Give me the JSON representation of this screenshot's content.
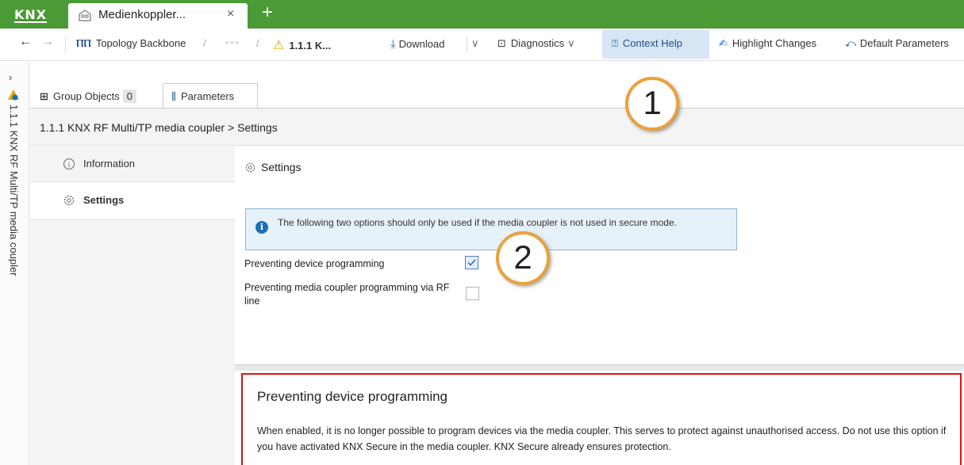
{
  "app": {
    "logo_text": "KNX",
    "tab_title": "Medienkoppler...",
    "tab_close": "×",
    "add_tab": "+"
  },
  "toolbar": {
    "back": "←",
    "forward": "→",
    "topology": "Topology Backbone",
    "slash1": "/",
    "ellipsis": "∘∘∘",
    "slash2": "/",
    "device": "1.1.1 K...",
    "download": "Download",
    "diagnostics": "Diagnostics",
    "context_help": "Context Help",
    "highlight_changes": "Highlight Changes",
    "default_parameters": "Default Parameters"
  },
  "side_strip": {
    "expand": "›",
    "device_label": "1.1.1 KNX RF Multi/TP media coupler"
  },
  "panel_tabs": {
    "group_objects": "Group Objects",
    "group_objects_count": "0",
    "parameters": "Parameters"
  },
  "breadcrumb": "1.1.1 KNX RF Multi/TP media coupler > Settings",
  "nav": {
    "items": [
      {
        "label": "Information"
      },
      {
        "label": "Settings"
      }
    ]
  },
  "settings": {
    "title": "Settings",
    "info_text": "The following two options should only be used if the media coupler is not used in secure mode.",
    "option1_label": "Preventing device programming",
    "option1_checked": true,
    "option2_label": "Preventing media coupler programming via RF line",
    "option2_checked": false
  },
  "callouts": {
    "one": "1",
    "two": "2"
  },
  "help": {
    "title": "Preventing device programming",
    "text": "When enabled, it is no longer possible to program devices via the media coupler. This serves to protect against unauthorised access. Do not use this option if you have activated KNX Secure in the media coupler. KNX Secure already ensures protection."
  },
  "colors": {
    "titlebar": "#4a9a35",
    "context_help_bg": "#d6e6f5",
    "callout_border": "#e8a23c",
    "help_frame": "#e01010",
    "info_icon": "#1e6fb5"
  }
}
